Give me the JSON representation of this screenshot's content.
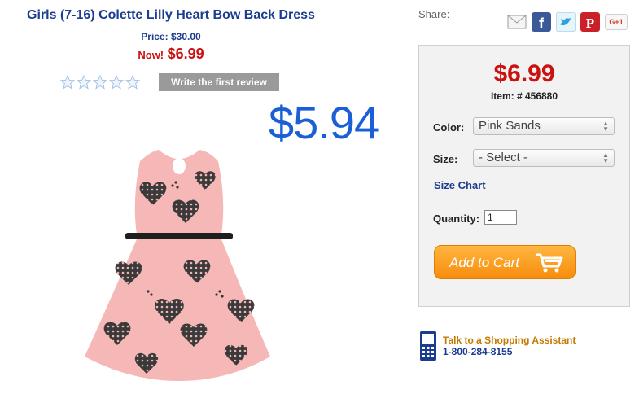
{
  "product": {
    "title": "Girls (7-16) Colette Lilly Heart Bow Back Dress",
    "price_label": "Price: $30.00",
    "now_label": "Now!",
    "now_price": "$6.99",
    "overlay_price": "$5.94"
  },
  "reviews": {
    "rating": 0,
    "max": 5,
    "button_label": "Write the first review"
  },
  "share": {
    "label": "Share:",
    "icons": [
      "email-icon",
      "facebook-icon",
      "twitter-icon",
      "pinterest-icon",
      "google-plus-icon"
    ],
    "google_plus_text": "G+1"
  },
  "cart_box": {
    "price": "$6.99",
    "item_number": "Item: # 456880",
    "color_label": "Color:",
    "color_value": "Pink Sands",
    "size_label": "Size:",
    "size_value": "- Select -",
    "size_chart_link": "Size Chart",
    "quantity_label": "Quantity:",
    "quantity_value": "1",
    "add_to_cart": "Add to Cart"
  },
  "assistant": {
    "line1": "Talk to a Shopping Assistant",
    "line2": "1-800-284-8155"
  },
  "colors": {
    "title_blue": "#1b3d8f",
    "price_red": "#cc1111",
    "overlay_blue": "#1a5fd6",
    "cart_orange": "#f78c0c"
  }
}
